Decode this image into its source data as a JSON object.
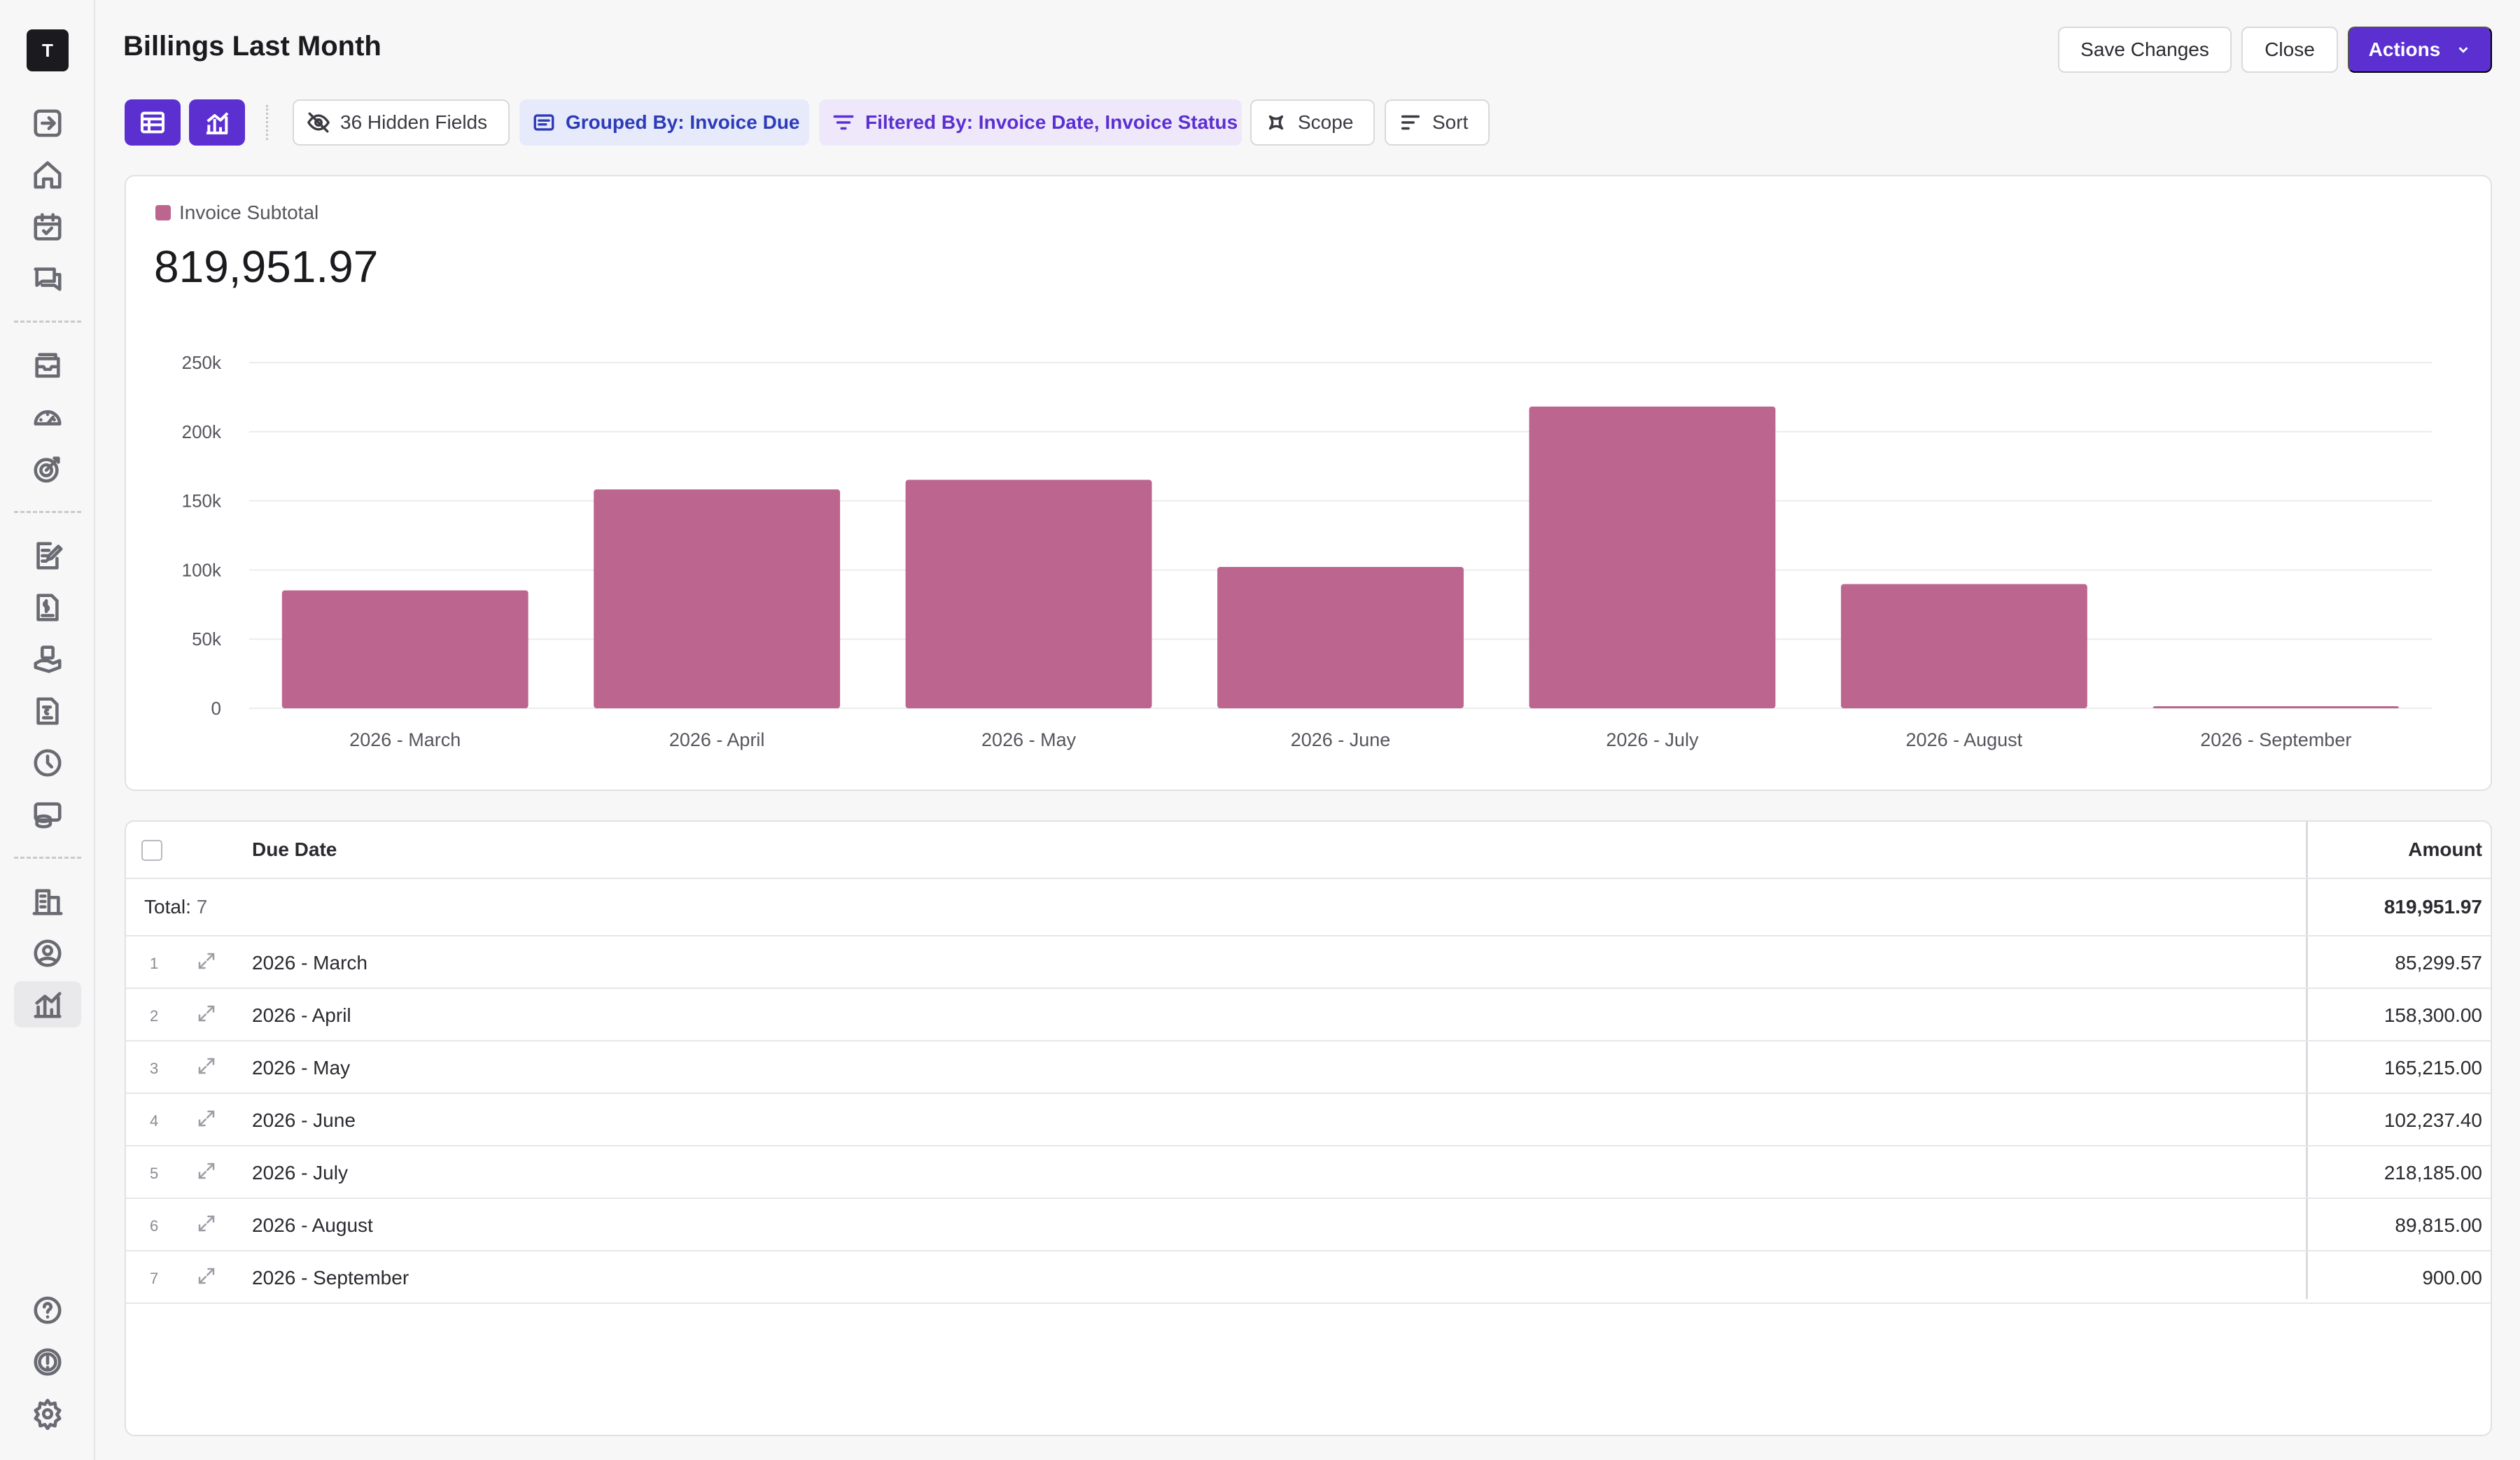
{
  "app": {
    "logo_letter": "T"
  },
  "sidebar": {
    "icons": [
      "log-in-icon",
      "home-icon",
      "calendar-check-icon",
      "messages-icon",
      "inbox-icon",
      "speedometer-icon",
      "target-icon",
      "edit-document-icon",
      "invoice-icon",
      "hand-coin-icon",
      "bill-icon",
      "clock-icon",
      "database-icon",
      "buildings-icon",
      "user-circle-icon",
      "chart-icon",
      "help-icon",
      "alert-icon",
      "gear-icon"
    ],
    "active": "chart-icon"
  },
  "header": {
    "title": "Billings Last Month",
    "save_label": "Save Changes",
    "close_label": "Close",
    "actions_label": "Actions"
  },
  "toolbar": {
    "hidden_fields": "36 Hidden Fields",
    "grouped_by": "Grouped By: Invoice Due",
    "filtered_by": "Filtered By: Invoice Date, Invoice Status",
    "scope": "Scope",
    "sort": "Sort"
  },
  "colors": {
    "accent": "#5b2fd0",
    "bar": "#bc668f"
  },
  "summary": {
    "legend": "Invoice Subtotal",
    "total": "819,951.97"
  },
  "chart_data": {
    "type": "bar",
    "categories": [
      "2026 - March",
      "2026 - April",
      "2026 - May",
      "2026 - June",
      "2026 - July",
      "2026 - August",
      "2026 - September"
    ],
    "series": [
      {
        "name": "Invoice Subtotal",
        "values": [
          85299.57,
          158300.0,
          165215.0,
          102237.4,
          218185.0,
          89815.0,
          900.0
        ]
      }
    ],
    "yticks": [
      "0",
      "50k",
      "100k",
      "150k",
      "200k",
      "250k"
    ],
    "ylim": [
      0,
      250000
    ],
    "grid": true,
    "legend": "top-left"
  },
  "table": {
    "columns": {
      "due_date": "Due Date",
      "amount": "Amount"
    },
    "total_label": "Total:",
    "total_count": "7",
    "total_amount": "819,951.97",
    "rows": [
      {
        "num": "1",
        "due": "2026 - March",
        "amount": "85,299.57"
      },
      {
        "num": "2",
        "due": "2026 - April",
        "amount": "158,300.00"
      },
      {
        "num": "3",
        "due": "2026 - May",
        "amount": "165,215.00"
      },
      {
        "num": "4",
        "due": "2026 - June",
        "amount": "102,237.40"
      },
      {
        "num": "5",
        "due": "2026 - July",
        "amount": "218,185.00"
      },
      {
        "num": "6",
        "due": "2026 - August",
        "amount": "89,815.00"
      },
      {
        "num": "7",
        "due": "2026 - September",
        "amount": "900.00"
      }
    ]
  }
}
